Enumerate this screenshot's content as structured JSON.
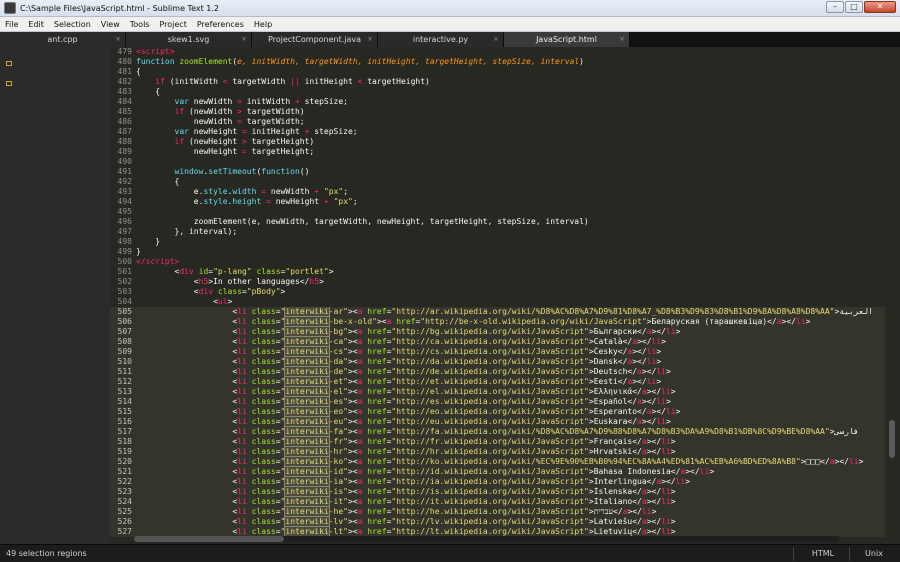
{
  "window": {
    "title": "C:\\Sample Files\\JavaScript.html - Sublime Text 1.2",
    "minimize": "–",
    "maximize": "□",
    "close": "✕"
  },
  "menu": [
    "File",
    "Edit",
    "Selection",
    "View",
    "Tools",
    "Project",
    "Preferences",
    "Help"
  ],
  "tabs": [
    {
      "label": "ant.cpp",
      "close": "×"
    },
    {
      "label": "skew1.svg",
      "close": "×"
    },
    {
      "label": "ProjectComponent.java",
      "close": "×"
    },
    {
      "label": "interactive.py",
      "close": "×"
    },
    {
      "label": "JavaScript.html",
      "close": "×"
    }
  ],
  "active_tab": 4,
  "code_lines": [
    {
      "n": "479",
      "html": "<span class=\"tg\">&lt;script&gt;</span>"
    },
    {
      "n": "480",
      "html": "<span class=\"bi\">function</span> <span class=\"fn\">zoomElement</span>(<span class=\"pm\">e, initWidth, targetWidth, initHeight, targetHeight, stepSize, interval</span>)"
    },
    {
      "n": "481",
      "html": "{"
    },
    {
      "n": "482",
      "html": "    <span class=\"kw\">if</span> (initWidth <span class=\"kw\">&lt;</span> targetWidth <span class=\"kw\">||</span> initHeight <span class=\"kw\">&lt;</span> targetHeight)"
    },
    {
      "n": "483",
      "html": "    {"
    },
    {
      "n": "484",
      "html": "        <span class=\"bi\">var</span> newWidth <span class=\"kw\">=</span> initWidth <span class=\"kw\">+</span> stepSize;"
    },
    {
      "n": "485",
      "html": "        <span class=\"kw\">if</span> (newWidth <span class=\"kw\">&gt;</span> targetWidth)"
    },
    {
      "n": "486",
      "html": "            newWidth <span class=\"kw\">=</span> targetWidth;"
    },
    {
      "n": "487",
      "html": "        <span class=\"bi\">var</span> newHeight <span class=\"kw\">=</span> initHeight <span class=\"kw\">+</span> stepSize;"
    },
    {
      "n": "488",
      "html": "        <span class=\"kw\">if</span> (newHeight <span class=\"kw\">&gt;</span> targetHeight)"
    },
    {
      "n": "489",
      "html": "            newHeight <span class=\"kw\">=</span> targetHeight;"
    },
    {
      "n": "490",
      "html": ""
    },
    {
      "n": "491",
      "html": "        <span class=\"bi\">window</span>.<span class=\"bi\">setTimeout</span>(<span class=\"bi\">function</span>()"
    },
    {
      "n": "492",
      "html": "        {"
    },
    {
      "n": "493",
      "html": "            e.<span class=\"bi\">style</span>.<span class=\"bi\">width</span> <span class=\"kw\">=</span> newWidth <span class=\"kw\">+</span> <span class=\"st\">\"px\"</span>;"
    },
    {
      "n": "494",
      "html": "            e.<span class=\"bi\">style</span>.<span class=\"bi\">height</span> <span class=\"kw\">=</span> newHeight <span class=\"kw\">+</span> <span class=\"st\">\"px\"</span>;"
    },
    {
      "n": "495",
      "html": ""
    },
    {
      "n": "496",
      "html": "            zoomElement(e, newWidth, targetWidth, newHeight, targetHeight, stepSize, interval)"
    },
    {
      "n": "497",
      "html": "        }, interval);"
    },
    {
      "n": "498",
      "html": "    }"
    },
    {
      "n": "499",
      "html": "}"
    },
    {
      "n": "500",
      "html": "<span class=\"tg\">&lt;/script&gt;</span>"
    },
    {
      "n": "501",
      "html": "        &lt;<span class=\"tg\">div</span> <span class=\"at\">id</span>=<span class=\"st\">\"p-lang\"</span> <span class=\"at\">class</span>=<span class=\"st\">\"portlet\"</span>&gt;"
    },
    {
      "n": "502",
      "html": "            &lt;<span class=\"tg\">h5</span>&gt;In other languages&lt;/<span class=\"tg\">h5</span>&gt;"
    },
    {
      "n": "503",
      "html": "            &lt;<span class=\"tg\">div</span> <span class=\"at\">class</span>=<span class=\"st\">\"pBody\"</span>&gt;"
    },
    {
      "n": "504",
      "html": "                &lt;<span class=\"tg\">ul</span>&gt;"
    },
    {
      "n": "505",
      "sel": true,
      "html": "                    &lt;<span class=\"tg\">li</span> <span class=\"at\">class</span>=<span class=\"st\">\"<span class=\"hl\">interwiki</span>-ar\"</span>&gt;&lt;<span class=\"tg\">a</span> <span class=\"at\">href</span>=<span class=\"st\">\"http://ar.wikipedia.org/wiki/%D8%AC%D8%A7%D9%81%D8%A7_%D8%B3%D9%83%D8%B1%D9%8A%D8%A8%D8%AA\"</span>&gt;العربية"
    },
    {
      "n": "506",
      "sel": true,
      "html": "                    &lt;<span class=\"tg\">li</span> <span class=\"at\">class</span>=<span class=\"st\">\"<span class=\"hl\">interwiki</span>-be-x-old\"</span>&gt;&lt;<span class=\"tg\">a</span> <span class=\"at\">href</span>=<span class=\"st\">\"http://be-x-old.wikipedia.org/wiki/JavaScript\"</span>&gt;Беларуская (тарашкевіца)&lt;/<span class=\"tg\">a</span>&gt;&lt;/<span class=\"tg\">li</span>&gt;"
    },
    {
      "n": "507",
      "sel": true,
      "html": "                    &lt;<span class=\"tg\">li</span> <span class=\"at\">class</span>=<span class=\"st\">\"<span class=\"hl\">interwiki</span>-bg\"</span>&gt;&lt;<span class=\"tg\">a</span> <span class=\"at\">href</span>=<span class=\"st\">\"http://bg.wikipedia.org/wiki/JavaScript\"</span>&gt;Български&lt;/<span class=\"tg\">a</span>&gt;&lt;/<span class=\"tg\">li</span>&gt;"
    },
    {
      "n": "508",
      "sel": true,
      "html": "                    &lt;<span class=\"tg\">li</span> <span class=\"at\">class</span>=<span class=\"st\">\"<span class=\"hl\">interwiki</span>-ca\"</span>&gt;&lt;<span class=\"tg\">a</span> <span class=\"at\">href</span>=<span class=\"st\">\"http://ca.wikipedia.org/wiki/JavaScript\"</span>&gt;Català&lt;/<span class=\"tg\">a</span>&gt;&lt;/<span class=\"tg\">li</span>&gt;"
    },
    {
      "n": "509",
      "sel": true,
      "html": "                    &lt;<span class=\"tg\">li</span> <span class=\"at\">class</span>=<span class=\"st\">\"<span class=\"hl\">interwiki</span>-cs\"</span>&gt;&lt;<span class=\"tg\">a</span> <span class=\"at\">href</span>=<span class=\"st\">\"http://cs.wikipedia.org/wiki/JavaScript\"</span>&gt;Česky&lt;/<span class=\"tg\">a</span>&gt;&lt;/<span class=\"tg\">li</span>&gt;"
    },
    {
      "n": "510",
      "sel": true,
      "html": "                    &lt;<span class=\"tg\">li</span> <span class=\"at\">class</span>=<span class=\"st\">\"<span class=\"hl\">interwiki</span>-da\"</span>&gt;&lt;<span class=\"tg\">a</span> <span class=\"at\">href</span>=<span class=\"st\">\"http://da.wikipedia.org/wiki/JavaScript\"</span>&gt;Dansk&lt;/<span class=\"tg\">a</span>&gt;&lt;/<span class=\"tg\">li</span>&gt;"
    },
    {
      "n": "511",
      "sel": true,
      "html": "                    &lt;<span class=\"tg\">li</span> <span class=\"at\">class</span>=<span class=\"st\">\"<span class=\"hl\">interwiki</span>-de\"</span>&gt;&lt;<span class=\"tg\">a</span> <span class=\"at\">href</span>=<span class=\"st\">\"http://de.wikipedia.org/wiki/JavaScript\"</span>&gt;Deutsch&lt;/<span class=\"tg\">a</span>&gt;&lt;/<span class=\"tg\">li</span>&gt;"
    },
    {
      "n": "512",
      "sel": true,
      "html": "                    &lt;<span class=\"tg\">li</span> <span class=\"at\">class</span>=<span class=\"st\">\"<span class=\"hl\">interwiki</span>-et\"</span>&gt;&lt;<span class=\"tg\">a</span> <span class=\"at\">href</span>=<span class=\"st\">\"http://et.wikipedia.org/wiki/JavaScript\"</span>&gt;Eesti&lt;/<span class=\"tg\">a</span>&gt;&lt;/<span class=\"tg\">li</span>&gt;"
    },
    {
      "n": "513",
      "sel": true,
      "html": "                    &lt;<span class=\"tg\">li</span> <span class=\"at\">class</span>=<span class=\"st\">\"<span class=\"hl\">interwiki</span>-el\"</span>&gt;&lt;<span class=\"tg\">a</span> <span class=\"at\">href</span>=<span class=\"st\">\"http://el.wikipedia.org/wiki/JavaScript\"</span>&gt;Ελληνικά&lt;/<span class=\"tg\">a</span>&gt;&lt;/<span class=\"tg\">li</span>&gt;"
    },
    {
      "n": "514",
      "sel": true,
      "html": "                    &lt;<span class=\"tg\">li</span> <span class=\"at\">class</span>=<span class=\"st\">\"<span class=\"hl\">interwiki</span>-es\"</span>&gt;&lt;<span class=\"tg\">a</span> <span class=\"at\">href</span>=<span class=\"st\">\"http://es.wikipedia.org/wiki/JavaScript\"</span>&gt;Español&lt;/<span class=\"tg\">a</span>&gt;&lt;/<span class=\"tg\">li</span>&gt;"
    },
    {
      "n": "515",
      "sel": true,
      "html": "                    &lt;<span class=\"tg\">li</span> <span class=\"at\">class</span>=<span class=\"st\">\"<span class=\"hl\">interwiki</span>-eo\"</span>&gt;&lt;<span class=\"tg\">a</span> <span class=\"at\">href</span>=<span class=\"st\">\"http://eo.wikipedia.org/wiki/JavaScript\"</span>&gt;Esperanto&lt;/<span class=\"tg\">a</span>&gt;&lt;/<span class=\"tg\">li</span>&gt;"
    },
    {
      "n": "516",
      "sel": true,
      "html": "                    &lt;<span class=\"tg\">li</span> <span class=\"at\">class</span>=<span class=\"st\">\"<span class=\"hl\">interwiki</span>-eu\"</span>&gt;&lt;<span class=\"tg\">a</span> <span class=\"at\">href</span>=<span class=\"st\">\"http://eu.wikipedia.org/wiki/JavaScript\"</span>&gt;Euskara&lt;/<span class=\"tg\">a</span>&gt;&lt;/<span class=\"tg\">li</span>&gt;"
    },
    {
      "n": "517",
      "sel": true,
      "html": "                    &lt;<span class=\"tg\">li</span> <span class=\"at\">class</span>=<span class=\"st\">\"<span class=\"hl\">interwiki</span>-fa\"</span>&gt;&lt;<span class=\"tg\">a</span> <span class=\"at\">href</span>=<span class=\"st\">\"http://fa.wikipedia.org/wiki/%D8%AC%D8%A7%D9%88%D8%A7%D8%B3%DA%A9%D8%B1%DB%8C%D9%BE%D8%AA\"</span>&gt;فارسی"
    },
    {
      "n": "518",
      "sel": true,
      "html": "                    &lt;<span class=\"tg\">li</span> <span class=\"at\">class</span>=<span class=\"st\">\"<span class=\"hl\">interwiki</span>-fr\"</span>&gt;&lt;<span class=\"tg\">a</span> <span class=\"at\">href</span>=<span class=\"st\">\"http://fr.wikipedia.org/wiki/JavaScript\"</span>&gt;Français&lt;/<span class=\"tg\">a</span>&gt;&lt;/<span class=\"tg\">li</span>&gt;"
    },
    {
      "n": "519",
      "sel": true,
      "html": "                    &lt;<span class=\"tg\">li</span> <span class=\"at\">class</span>=<span class=\"st\">\"<span class=\"hl\">interwiki</span>-hr\"</span>&gt;&lt;<span class=\"tg\">a</span> <span class=\"at\">href</span>=<span class=\"st\">\"http://hr.wikipedia.org/wiki/JavaScript\"</span>&gt;Hrvatski&lt;/<span class=\"tg\">a</span>&gt;&lt;/<span class=\"tg\">li</span>&gt;"
    },
    {
      "n": "520",
      "sel": true,
      "html": "                    &lt;<span class=\"tg\">li</span> <span class=\"at\">class</span>=<span class=\"st\">\"<span class=\"hl\">interwiki</span>-ko\"</span>&gt;&lt;<span class=\"tg\">a</span> <span class=\"at\">href</span>=<span class=\"st\">\"http://ko.wikipedia.org/wiki/%EC%9E%90%EB%B0%94%EC%8A%A4%ED%81%AC%EB%A6%BD%ED%8A%B8\"</span>&gt;□□□&lt;/<span class=\"tg\">a</span>&gt;&lt;/<span class=\"tg\">li</span>&gt;"
    },
    {
      "n": "521",
      "sel": true,
      "html": "                    &lt;<span class=\"tg\">li</span> <span class=\"at\">class</span>=<span class=\"st\">\"<span class=\"hl\">interwiki</span>-id\"</span>&gt;&lt;<span class=\"tg\">a</span> <span class=\"at\">href</span>=<span class=\"st\">\"http://id.wikipedia.org/wiki/JavaScript\"</span>&gt;Bahasa Indonesia&lt;/<span class=\"tg\">a</span>&gt;&lt;/<span class=\"tg\">li</span>&gt;"
    },
    {
      "n": "522",
      "sel": true,
      "html": "                    &lt;<span class=\"tg\">li</span> <span class=\"at\">class</span>=<span class=\"st\">\"<span class=\"hl\">interwiki</span>-ia\"</span>&gt;&lt;<span class=\"tg\">a</span> <span class=\"at\">href</span>=<span class=\"st\">\"http://ia.wikipedia.org/wiki/JavaScript\"</span>&gt;Interlingua&lt;/<span class=\"tg\">a</span>&gt;&lt;/<span class=\"tg\">li</span>&gt;"
    },
    {
      "n": "523",
      "sel": true,
      "html": "                    &lt;<span class=\"tg\">li</span> <span class=\"at\">class</span>=<span class=\"st\">\"<span class=\"hl\">interwiki</span>-is\"</span>&gt;&lt;<span class=\"tg\">a</span> <span class=\"at\">href</span>=<span class=\"st\">\"http://is.wikipedia.org/wiki/JavaScript\"</span>&gt;Íslenska&lt;/<span class=\"tg\">a</span>&gt;&lt;/<span class=\"tg\">li</span>&gt;"
    },
    {
      "n": "524",
      "sel": true,
      "html": "                    &lt;<span class=\"tg\">li</span> <span class=\"at\">class</span>=<span class=\"st\">\"<span class=\"hl\">interwiki</span>-it\"</span>&gt;&lt;<span class=\"tg\">a</span> <span class=\"at\">href</span>=<span class=\"st\">\"http://it.wikipedia.org/wiki/JavaScript\"</span>&gt;Italiano&lt;/<span class=\"tg\">a</span>&gt;&lt;/<span class=\"tg\">li</span>&gt;"
    },
    {
      "n": "525",
      "sel": true,
      "html": "                    &lt;<span class=\"tg\">li</span> <span class=\"at\">class</span>=<span class=\"st\">\"<span class=\"hl\">interwiki</span>-he\"</span>&gt;&lt;<span class=\"tg\">a</span> <span class=\"at\">href</span>=<span class=\"st\">\"http://he.wikipedia.org/wiki/JavaScript\"</span>&gt;עברית&lt;/<span class=\"tg\">a</span>&gt;&lt;/<span class=\"tg\">li</span>&gt;"
    },
    {
      "n": "526",
      "sel": true,
      "html": "                    &lt;<span class=\"tg\">li</span> <span class=\"at\">class</span>=<span class=\"st\">\"<span class=\"hl\">interwiki</span>-lv\"</span>&gt;&lt;<span class=\"tg\">a</span> <span class=\"at\">href</span>=<span class=\"st\">\"http://lv.wikipedia.org/wiki/JavaScript\"</span>&gt;Latviešu&lt;/<span class=\"tg\">a</span>&gt;&lt;/<span class=\"tg\">li</span>&gt;"
    },
    {
      "n": "527",
      "sel": true,
      "html": "                    &lt;<span class=\"tg\">li</span> <span class=\"at\">class</span>=<span class=\"st\">\"<span class=\"hl\">interwiki</span>-lt\"</span>&gt;&lt;<span class=\"tg\">a</span> <span class=\"at\">href</span>=<span class=\"st\">\"http://lt.wikipedia.org/wiki/JavaScript\"</span>&gt;Lietuvių&lt;/<span class=\"tg\">a</span>&gt;&lt;/<span class=\"tg\">li</span>&gt;"
    }
  ],
  "status": {
    "selection": "49 selection regions",
    "syntax": "HTML",
    "line_endings": "Unix"
  },
  "colors": {
    "editor_bg": "#272822",
    "keyword": "#f92672",
    "string": "#e6db74",
    "function": "#a6e22e",
    "builtin": "#66d9ef",
    "parameter": "#fd971f"
  }
}
